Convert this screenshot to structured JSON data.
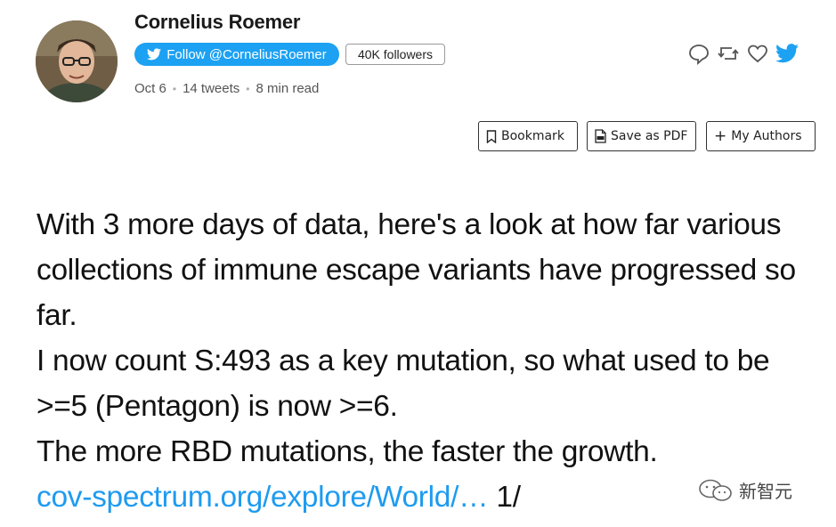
{
  "author": {
    "name": "Cornelius Roemer",
    "follow_label": "Follow @CorneliusRoemer",
    "followers": "40K followers"
  },
  "meta": {
    "date": "Oct 6",
    "tweets": "14 tweets",
    "read_time": "8 min read"
  },
  "actions": [
    "reply-icon",
    "retweet-icon",
    "like-icon",
    "twitter-icon"
  ],
  "toolbar": {
    "bookmark_label": "Bookmark",
    "save_pdf_label": "Save as PDF",
    "my_authors_label": "My Authors"
  },
  "tweet": {
    "line1": "With 3 more days of data, here's a look at how far various collections of immune escape variants have progressed so far.",
    "line2": "I now count S:493 as a key mutation, so what used to be >=5 (Pentagon) is now >=6.",
    "line3": "The more RBD mutations, the faster the growth.",
    "link_text": "cov-spectrum.org/explore/World/…",
    "thread_index": "1/"
  },
  "watermark": {
    "text": "新智元"
  },
  "colors": {
    "twitter_blue": "#1da1f2",
    "link": "#1d9bf0"
  }
}
